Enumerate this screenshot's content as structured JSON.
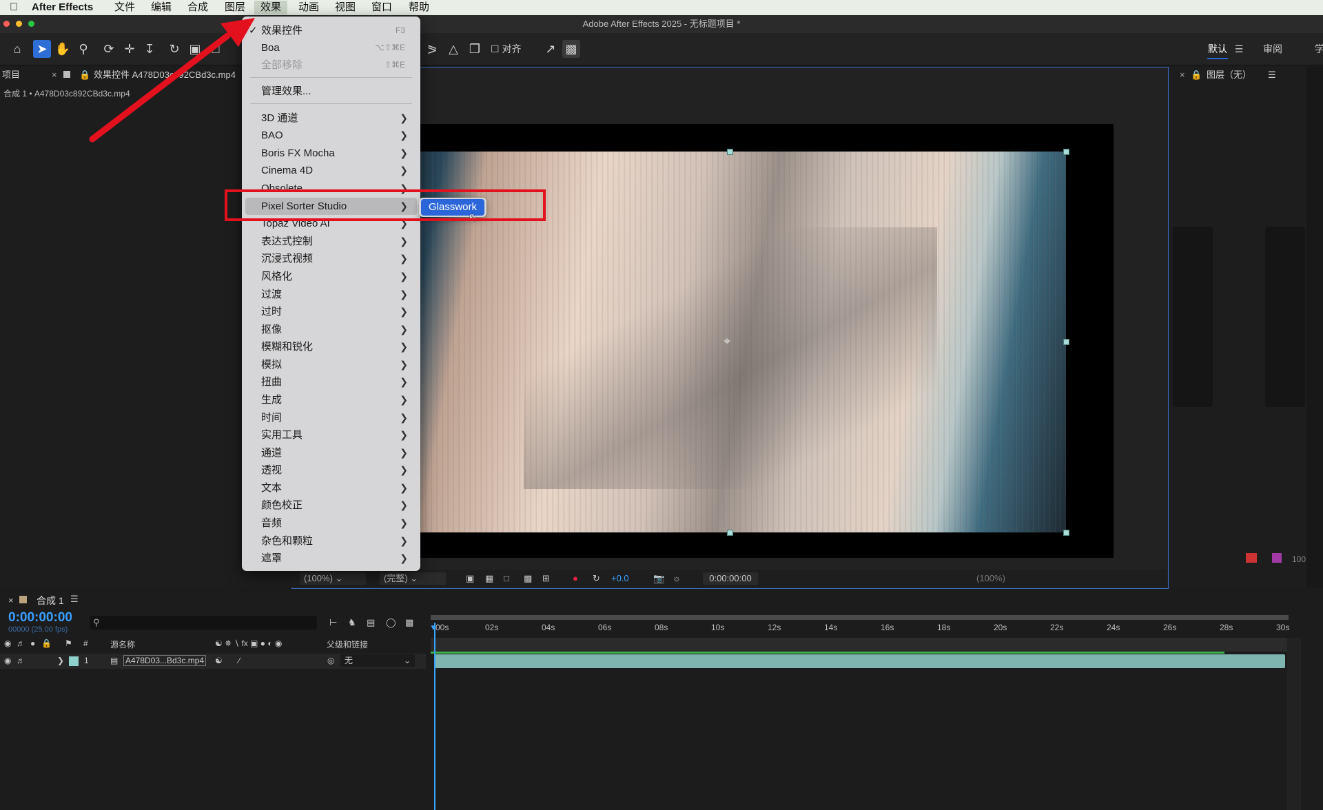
{
  "menubar": {
    "apple": "",
    "app_name": "After Effects",
    "items": [
      "文件",
      "编辑",
      "合成",
      "图层",
      "效果",
      "动画",
      "视图",
      "窗口",
      "帮助"
    ]
  },
  "window_title": "Adobe After Effects 2025 - 无标题项目 *",
  "toolbar": {
    "align_label": "对齐",
    "workspace_default": "默认",
    "workspace_review": "审阅",
    "workspace_extra": "学"
  },
  "project_panel": {
    "tab_label": "项目",
    "breadcrumb": "合成 1 • A478D03c892CBd3c.mp4",
    "effects_tab": "效果控件 A478D03c892CBd3c.mp4"
  },
  "layer_panel": {
    "title": "图层（无）"
  },
  "effect_menu": {
    "items": [
      {
        "label": "效果控件",
        "shortcut": "F3",
        "checked": true
      },
      {
        "label": "Boa",
        "shortcut": "⌥⇧⌘E"
      },
      {
        "label": "全部移除",
        "shortcut": "⇧⌘E",
        "disabled": true
      },
      {
        "label": "管理效果..."
      },
      {
        "label": "3D 通道",
        "submenu": true
      },
      {
        "label": "BAO",
        "submenu": true
      },
      {
        "label": "Boris FX Mocha",
        "submenu": true
      },
      {
        "label": "Cinema 4D",
        "submenu": true
      },
      {
        "label": "Obsolete",
        "submenu": true
      },
      {
        "label": "Pixel Sorter Studio",
        "submenu": true,
        "highlighted": true
      },
      {
        "label": "Topaz Video AI",
        "submenu": true
      },
      {
        "label": "表达式控制",
        "submenu": true
      },
      {
        "label": "沉浸式视频",
        "submenu": true
      },
      {
        "label": "风格化",
        "submenu": true
      },
      {
        "label": "过渡",
        "submenu": true
      },
      {
        "label": "过时",
        "submenu": true
      },
      {
        "label": "抠像",
        "submenu": true
      },
      {
        "label": "模糊和锐化",
        "submenu": true
      },
      {
        "label": "模拟",
        "submenu": true
      },
      {
        "label": "扭曲",
        "submenu": true
      },
      {
        "label": "生成",
        "submenu": true
      },
      {
        "label": "时间",
        "submenu": true
      },
      {
        "label": "实用工具",
        "submenu": true
      },
      {
        "label": "通道",
        "submenu": true
      },
      {
        "label": "透视",
        "submenu": true
      },
      {
        "label": "文本",
        "submenu": true
      },
      {
        "label": "颜色校正",
        "submenu": true
      },
      {
        "label": "音频",
        "submenu": true
      },
      {
        "label": "杂色和颗粒",
        "submenu": true
      },
      {
        "label": "遮罩",
        "submenu": true
      }
    ],
    "submenu_item": "Glasswork"
  },
  "viewer_footer": {
    "zoom": "(100%)",
    "quality": "(完整)",
    "exposure": "+0.0",
    "timecode": "0:00:00:00",
    "right_zoom": "(100%)",
    "right_value": "100"
  },
  "timeline": {
    "comp_tab": "合成 1",
    "timecode": "0:00:00:00",
    "frame_info": "00000 (25.00 fps)",
    "search_placeholder": "",
    "col_hash": "#",
    "col_source": "源名称",
    "col_parent": "父级和链接",
    "layer": {
      "index": "1",
      "name": "A478D03...Bd3c.mp4",
      "parent": "无"
    },
    "ruler": [
      "00s",
      "02s",
      "04s",
      "06s",
      "08s",
      "10s",
      "12s",
      "14s",
      "16s",
      "18s",
      "20s",
      "22s",
      "24s",
      "26s",
      "28s",
      "30s"
    ]
  },
  "colors": {
    "accent_blue": "#2a66d9",
    "annotation_red": "#e3111e",
    "timecode_blue": "#3aa0ff",
    "layer_bar": "#7fb5b1"
  }
}
